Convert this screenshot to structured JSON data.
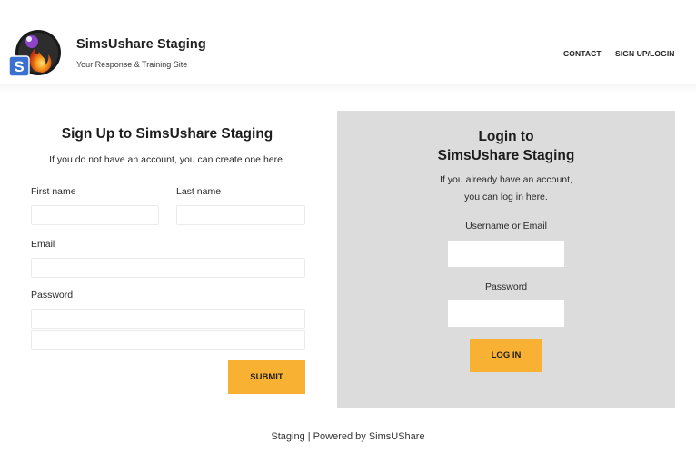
{
  "header": {
    "site_title": "SimsUshare Staging",
    "tagline": "Your Response & Training Site",
    "logo_badge": "S",
    "nav": [
      "CONTACT",
      "SIGN UP/LOGIN"
    ]
  },
  "signup": {
    "title": "Sign Up to SimsUshare Staging",
    "subtitle": "If you do not have an account, you can create one here.",
    "first_name_label": "First name",
    "last_name_label": "Last name",
    "email_label": "Email",
    "password_label": "Password",
    "first_name_value": "",
    "last_name_value": "",
    "email_value": "",
    "password_value": "",
    "password_confirm_value": "",
    "submit_label": "SUBMIT"
  },
  "login": {
    "title_line1": "Login to",
    "title_line2": "SimsUshare Staging",
    "subtitle_line1": "If you already have an account,",
    "subtitle_line2": "you can log in here.",
    "username_label": "Username or Email",
    "password_label": "Password",
    "username_value": "",
    "password_value": "",
    "button_label": "LOG IN"
  },
  "footer": {
    "text": "Staging | Powered by SimsUShare"
  },
  "colors": {
    "accent": "#f9b133",
    "panel_bg": "#dcdcdc",
    "logo_badge": "#3b6fd0"
  },
  "icons": {
    "logo": "simsushare-logo-icon"
  }
}
